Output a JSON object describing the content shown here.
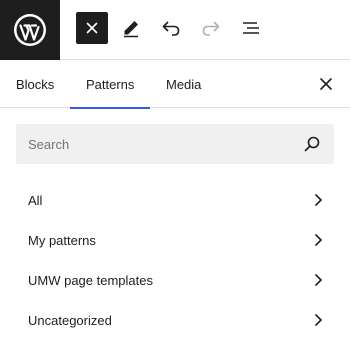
{
  "toolbar": {
    "logo_icon": "wordpress-logo-icon",
    "buttons": [
      {
        "name": "close-inserter-button",
        "icon": "close-icon"
      },
      {
        "name": "tools-button",
        "icon": "pencil-icon"
      },
      {
        "name": "undo-button",
        "icon": "undo-icon"
      },
      {
        "name": "redo-button",
        "icon": "redo-icon"
      },
      {
        "name": "document-overview-button",
        "icon": "list-view-icon"
      }
    ]
  },
  "tabs": [
    {
      "label": "Blocks",
      "active": false
    },
    {
      "label": "Patterns",
      "active": true
    },
    {
      "label": "Media",
      "active": false
    }
  ],
  "search": {
    "placeholder": "Search",
    "value": ""
  },
  "categories": [
    {
      "label": "All"
    },
    {
      "label": "My patterns"
    },
    {
      "label": "UMW page templates"
    },
    {
      "label": "Uncategorized"
    }
  ],
  "colors": {
    "accent": "#3858e9",
    "dark": "#1e1e1e",
    "search_bg": "#f0f0f0"
  }
}
